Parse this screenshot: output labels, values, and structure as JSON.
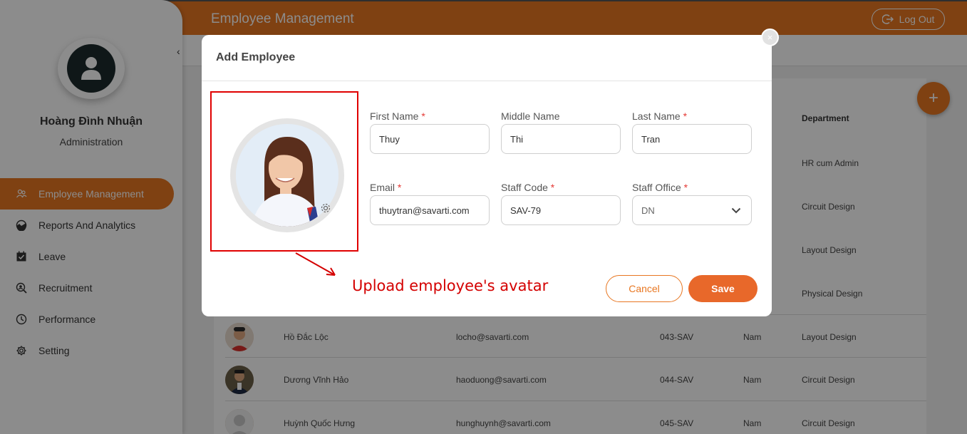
{
  "header": {
    "title": "Employee Management",
    "logout_label": "Log Out"
  },
  "user": {
    "name": "Hoàng Đình Nhuận",
    "role": "Administration"
  },
  "sidebar": {
    "items": [
      {
        "label": "Employee Management",
        "icon": "users-icon",
        "active": true
      },
      {
        "label": "Reports And Analytics",
        "icon": "chart-icon"
      },
      {
        "label": "Leave",
        "icon": "calendar-check-icon"
      },
      {
        "label": "Recruitment",
        "icon": "recruitment-icon"
      },
      {
        "label": "Performance",
        "icon": "performance-icon"
      },
      {
        "label": "Setting",
        "icon": "gear-icon"
      }
    ]
  },
  "table": {
    "department_header": "Department",
    "hidden_departments": [
      "HR cum Admin",
      "Circuit Design",
      "Layout Design",
      "Physical Design"
    ],
    "rows": [
      {
        "name": "Hồ Đắc Lộc",
        "email": "locho@savarti.com",
        "code": "043-SAV",
        "gender": "Nam",
        "department": "Layout Design"
      },
      {
        "name": "Dương Vĩnh Hảo",
        "email": "haoduong@savarti.com",
        "code": "044-SAV",
        "gender": "Nam",
        "department": "Circuit Design"
      },
      {
        "name": "Huỳnh Quốc Hưng",
        "email": "hunghuynh@savarti.com",
        "code": "045-SAV",
        "gender": "Nam",
        "department": "Circuit Design"
      }
    ]
  },
  "fab_label": "+",
  "modal": {
    "title": "Add Employee",
    "close_label": "×",
    "fields": {
      "first_name": {
        "label": "First Name",
        "required": "*",
        "value": "Thuy"
      },
      "middle_name": {
        "label": "Middle Name",
        "value": "Thi"
      },
      "last_name": {
        "label": "Last Name",
        "required": "*",
        "value": "Tran"
      },
      "email": {
        "label": "Email",
        "required": "*",
        "value": "thuytran@savarti.com"
      },
      "staff_code": {
        "label": "Staff Code",
        "required": "*",
        "value": "SAV-79"
      },
      "staff_office": {
        "label": "Staff Office",
        "required": "*",
        "value": "DN"
      }
    },
    "cancel_label": "Cancel",
    "save_label": "Save"
  },
  "annotation": {
    "text": "Upload employee's avatar",
    "color": "#d40000"
  },
  "colors": {
    "accent": "#e87722",
    "save": "#e8682a",
    "required": "#e53935"
  }
}
